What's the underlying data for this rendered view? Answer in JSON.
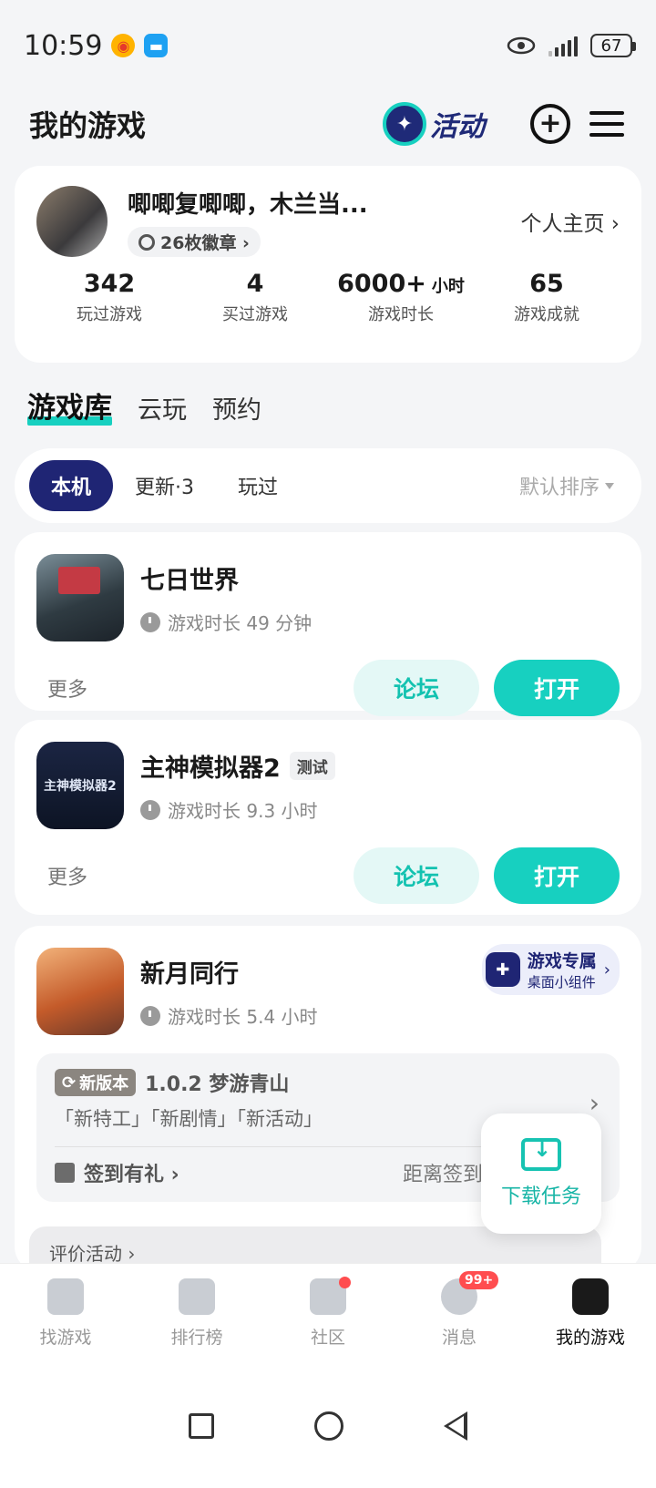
{
  "status_bar": {
    "time": "10:59",
    "battery": "67"
  },
  "header": {
    "title": "我的游戏",
    "activity_label": "活动"
  },
  "profile": {
    "name": "唧唧复唧唧，木兰当...",
    "badges": "26枚徽章 ›",
    "homepage_link": "个人主页 ›",
    "stats": [
      {
        "value": "342",
        "unit": "",
        "label": "玩过游戏"
      },
      {
        "value": "4",
        "unit": "",
        "label": "买过游戏"
      },
      {
        "value": "6000+",
        "unit": "小时",
        "label": "游戏时长"
      },
      {
        "value": "65",
        "unit": "",
        "label": "游戏成就"
      }
    ]
  },
  "library_tabs": [
    "游戏库",
    "云玩",
    "预约"
  ],
  "filters": {
    "chips": [
      "本机",
      "更新·3",
      "玩过"
    ],
    "sort": "默认排序"
  },
  "games": [
    {
      "name": "七日世界",
      "tag": "",
      "playtime": "游戏时长 49 分钟",
      "more": "更多",
      "forum": "论坛",
      "open": "打开"
    },
    {
      "name": "主神模拟器2",
      "tag": "测试",
      "icon_text": "主神模拟器2",
      "playtime": "游戏时长 9.3 小时",
      "more": "更多",
      "forum": "论坛",
      "open": "打开"
    },
    {
      "name": "新月同行",
      "playtime": "游戏时长 5.4 小时",
      "widget": {
        "title": "游戏专属",
        "subtitle": "桌面小组件"
      },
      "version": {
        "tag": "新版本",
        "title": "1.0.2 梦游青山",
        "tags": "「新特工」「新剧情」「新活动」"
      },
      "checkin": {
        "label": "签到有礼 ›",
        "right": "距离签到结"
      },
      "review": "评价活动 ›"
    }
  ],
  "download_float": {
    "label": "下载任务"
  },
  "bottom_nav": [
    {
      "label": "找游戏",
      "icon": "find-game-icon"
    },
    {
      "label": "排行榜",
      "icon": "ranking-icon"
    },
    {
      "label": "社区",
      "icon": "community-icon"
    },
    {
      "label": "消息",
      "icon": "message-icon",
      "badge": "99+"
    },
    {
      "label": "我的游戏",
      "icon": "my-games-icon"
    }
  ]
}
